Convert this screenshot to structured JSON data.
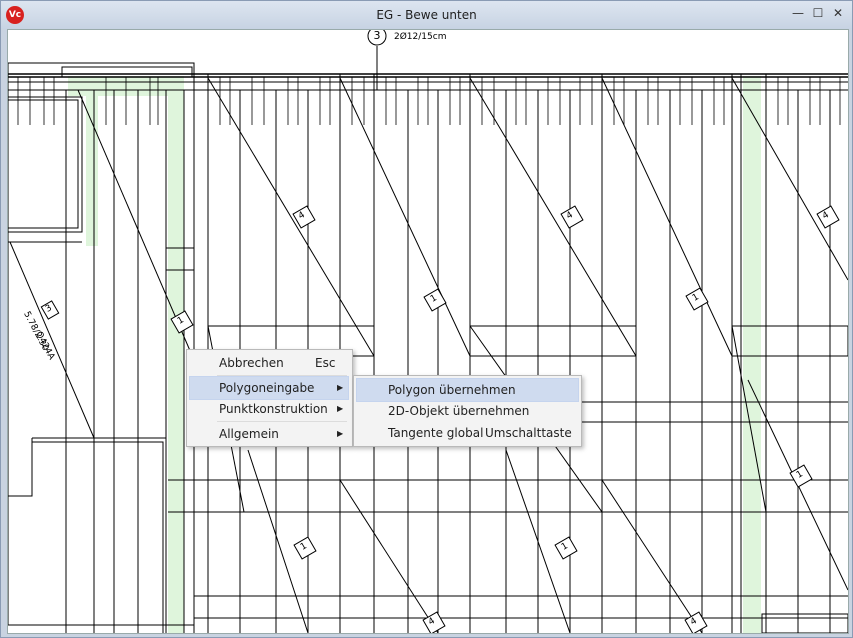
{
  "window": {
    "title": "EG - Bewe unten",
    "app_icon": "Vc",
    "minimize_glyph": "—",
    "maximize_glyph": "☐",
    "close_glyph": "✕"
  },
  "drawing": {
    "dimension_label": "2Ø12/15cm",
    "marker_number": "3",
    "rebar_tag_number": "3",
    "rebar_tag_spec": "Q424A",
    "rebar_tag_dims": "5.78/2.30",
    "tag_1": "1",
    "tag_4": "4"
  },
  "context_menu": {
    "items": [
      {
        "label": "Abbrechen",
        "shortcut": "Esc"
      },
      {
        "label": "Polygoneingabe",
        "submenu": true
      },
      {
        "label": "Punktkonstruktion",
        "submenu": true
      },
      {
        "label": "Allgemein",
        "submenu": true
      }
    ],
    "arrow_glyph": "▶"
  },
  "submenu": {
    "items": [
      {
        "label": "Polygon übernehmen"
      },
      {
        "label": "2D-Objekt übernehmen"
      },
      {
        "label": "Tangente global",
        "shortcut": "Umschalttaste"
      }
    ]
  },
  "colors": {
    "highlight": "#cfdbef",
    "hatch_green": "#dff5dc"
  }
}
